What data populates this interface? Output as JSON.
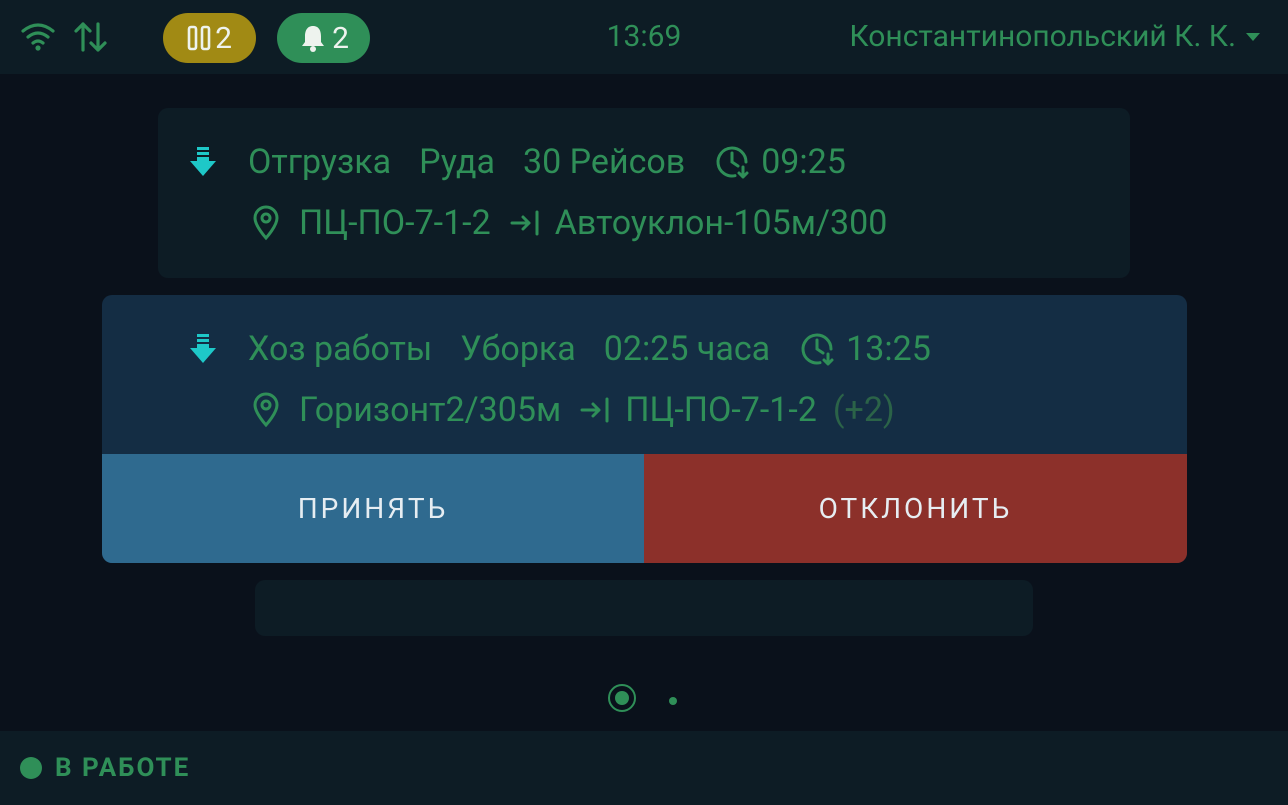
{
  "status_bar": {
    "pause_count": "2",
    "notification_count": "2",
    "time": "13:69",
    "user_name": "Константинопольский К. К."
  },
  "icons": {
    "wifi": "wifi-icon",
    "data_transfer": "up-down-arrows-icon",
    "pause": "pause-icon",
    "bell": "bell-icon",
    "unload": "download-arrow-icon",
    "clock": "clock-icon",
    "location": "location-pin-icon",
    "route_arrow": "arrow-to-line-icon"
  },
  "tasks": [
    {
      "type": "Отгрузка",
      "material": "Руда",
      "amount": "30 Рейсов",
      "time": "09:25",
      "from": "ПЦ-ПО-7-1-2",
      "to": "Автоуклон-105м/300"
    },
    {
      "type": "Хоз работы",
      "material": "Уборка",
      "amount": "02:25 часа",
      "time": "13:25",
      "from": "Горизонт2/305м",
      "to": "ПЦ-ПО-7-1-2",
      "extra": "(+2)",
      "accept_label": "ПРИНЯТЬ",
      "reject_label": "ОТКЛОНИТЬ"
    }
  ],
  "bottom_bar": {
    "status": "В РАБОТЕ"
  },
  "colors": {
    "background": "#0a111b",
    "bar": "#0d1c25",
    "accent_green": "#2f8f58",
    "accent_teal": "#1ec8c8",
    "pause_badge": "#a18a14",
    "selected_card": "#142d44",
    "accept": "#2f6a8f",
    "reject": "#8c302a"
  },
  "pager": {
    "page_count": 2,
    "current_page": 1
  }
}
